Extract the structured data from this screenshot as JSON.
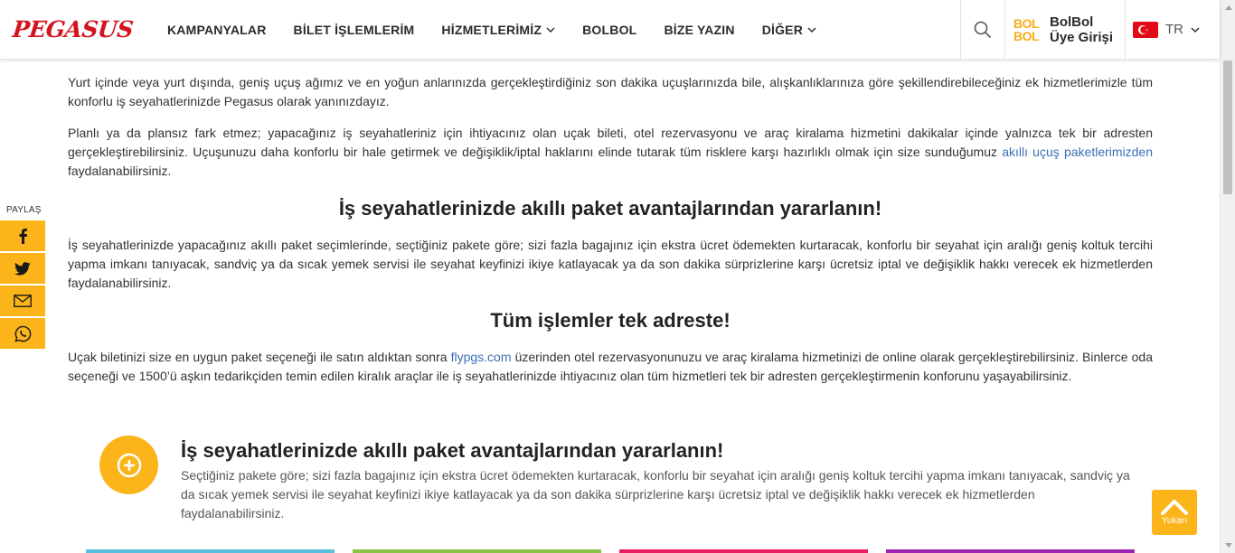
{
  "header": {
    "logo": "PEGASUS",
    "nav": [
      {
        "label": "KAMPANYALAR",
        "dropdown": false
      },
      {
        "label": "BİLET İŞLEMLERİM",
        "dropdown": false
      },
      {
        "label": "HİZMETLERİMİZ",
        "dropdown": true
      },
      {
        "label": "BOLBOL",
        "dropdown": false
      },
      {
        "label": "BİZE YAZIN",
        "dropdown": false
      },
      {
        "label": "DİĞER",
        "dropdown": true
      }
    ],
    "bolbol": {
      "logo_line1": "BOL",
      "logo_line2": "BOL",
      "line1": "BolBol",
      "line2": "Üye Girişi"
    },
    "language": "TR"
  },
  "share": {
    "label": "PAYLAŞ",
    "buttons": [
      "facebook-icon",
      "twitter-icon",
      "email-icon",
      "whatsapp-icon"
    ]
  },
  "content": {
    "intro1": "Yurt içinde veya yurt dışında, geniş uçuş ağımız ve en yoğun anlarınızda gerçekleştirdiğiniz son dakika uçuşlarınızda bile, alışkanlıklarınıza göre şekillendirebileceğiniz ek hizmetlerimizle tüm konforlu iş seyahatlerinizde Pegasus olarak yanınızdayız.",
    "intro2_before": "Planlı ya da plansız fark etmez; yapacağınız iş seyahatleriniz için ihtiyacınız olan uçak bileti, otel rezervasyonu ve araç kiralama hizmetini dakikalar içinde yalnızca tek bir adresten gerçekleştirebilirsiniz. Uçuşunuzu daha konforlu bir hale getirmek ve değişiklik/iptal haklarını elinde tutarak tüm risklere karşı hazırlıklı olmak için size sunduğumuz ",
    "intro2_link": "akıllı uçuş paketlerimizden",
    "intro2_after": " faydalanabilirsiniz.",
    "heading1": "İş seyahatlerinizde akıllı paket avantajlarından yararlanın!",
    "para3": "İş seyahatlerinizde yapacağınız akıllı paket seçimlerinde, seçtiğiniz pakete göre; sizi fazla bagajınız için ekstra ücret ödemekten kurtaracak, konforlu bir seyahat için aralığı geniş koltuk tercihi yapma imkanı tanıyacak, sandviç ya da sıcak yemek servisi ile seyahat keyfinizi ikiye katlayacak ya da son dakika sürprizlerine karşı ücretsiz iptal ve değişiklik hakkı verecek ek hizmetlerden faydalanabilirsiniz.",
    "heading2": "Tüm işlemler tek adreste!",
    "para4_before": "Uçak biletinizi size en uygun paket seçeneği ile satın aldıktan sonra ",
    "para4_link": "flypgs.com",
    "para4_after": " üzerinden otel rezervasyonunuzu ve araç kiralama hizmetinizi de online olarak gerçekleştirebilirsiniz. Binlerce oda seçeneği ve 1500’ü aşkın tedarikçiden temin edilen kiralık araçlar ile iş seyahatlerinizde ihtiyacınız olan tüm hizmetleri tek bir adresten gerçekleştirmenin konforunu yaşayabilirsiniz."
  },
  "feature": {
    "icon": "plus-icon",
    "title": "İş seyahatlerinizde akıllı paket avantajlarından yararlanın!",
    "text": "Seçtiğiniz pakete göre; sizi fazla bagajınız için ekstra ücret ödemekten kurtaracak, konforlu bir seyahat için aralığı geniş koltuk tercihi yapma imkanı tanıyacak, sandviç ya da sıcak yemek servisi ile seyahat keyfinizi ikiye katlayacak ya da son dakika sürprizlerine karşı ücretsiz iptal ve değişiklik hakkı verecek ek hizmetlerden faydalanabilirsiniz."
  },
  "back_to_top": "Yukarı",
  "colors": {
    "brand_red": "#d4131d",
    "accent_yellow": "#fbb51b",
    "link_blue": "#3a6fb5",
    "card_colors": [
      "#5bc0de",
      "#8bc34a",
      "#e91e63",
      "#9c27b0"
    ]
  }
}
